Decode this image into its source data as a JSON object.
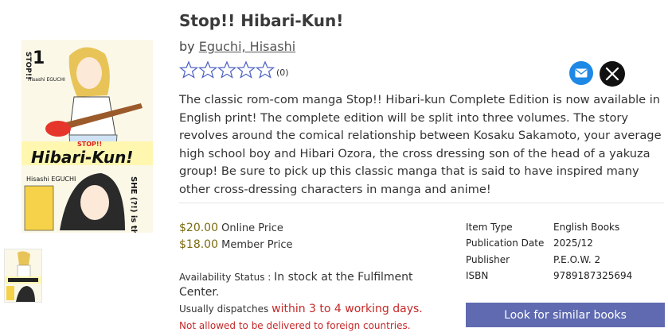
{
  "product": {
    "title": "Stop!! Hibari-Kun!",
    "by_label": "by",
    "author": "Eguchi, Hisashi",
    "rating_count": "(0)",
    "description": "The classic rom-com manga Stop!! Hibari-kun Complete Edition is now available in English print! The complete edition will be split into three volumes. The story revolves around the comical relationship between Kosaku Sakamoto, your average high school boy and Hibari Ozora, the cross dressing son of the head of a yakuza group! Be sure to pick up this classic manga that is said to have inspired many other cross-dressing characters in manga and anime!"
  },
  "cover": {
    "volume": "1",
    "title_text": "Hibari-Kun!",
    "stop_text": "STOP!!",
    "author_text": "Hisashi EGUCHI",
    "tagline": "SHE (?!) is the original"
  },
  "pricing": {
    "online_price": "$20.00",
    "online_label": "Online Price",
    "member_price": "$18.00",
    "member_label": "Member Price"
  },
  "availability": {
    "label": "Availability Status :",
    "status": "In stock at the Fulfilment Center.",
    "dispatch_prefix": "Usually dispatches",
    "dispatch_time": "within 3 to 4 working days.",
    "restriction": "Not allowed to be delivered to foreign countries."
  },
  "specs": [
    {
      "label": "Item Type",
      "value": "English Books"
    },
    {
      "label": "Publication Date",
      "value": "2025/12"
    },
    {
      "label": "Publisher",
      "value": "P.E.O.W. 2"
    },
    {
      "label": "ISBN",
      "value": "9789187325694"
    }
  ],
  "actions": {
    "similar_label": "Look for similar books"
  },
  "colors": {
    "price": "#7a6a10",
    "alert": "#c62828",
    "button": "#5f6ab0",
    "mail": "#1e88e5"
  },
  "icons": [
    "star-outline-icon",
    "mail-icon",
    "x-logo-icon"
  ]
}
